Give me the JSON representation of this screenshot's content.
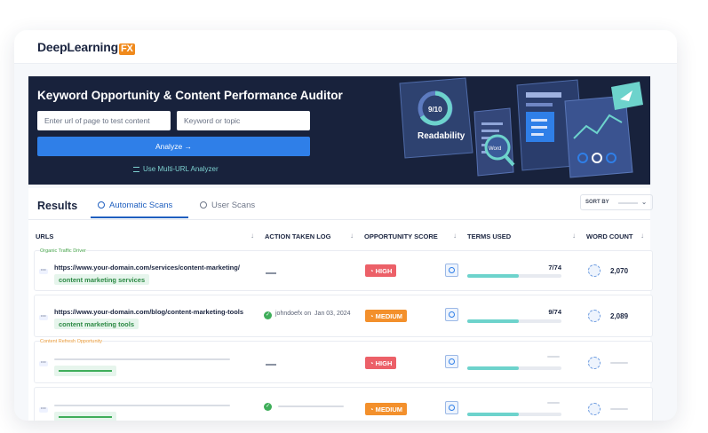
{
  "brand": {
    "name": "DeepLearning",
    "fx": "FX"
  },
  "hero": {
    "title": "Keyword Opportunity & Content Performance Auditor",
    "url_placeholder": "Enter url of page to test content",
    "keyword_placeholder": "Keyword or topic",
    "analyze_label": "Analyze →",
    "multi_label": "Use Multi-URL Analyzer",
    "readability_score": "9/10",
    "readability_label": "Readability",
    "word_label": "Word"
  },
  "results": {
    "title": "Results",
    "tabs": [
      {
        "label": "Automatic Scans"
      },
      {
        "label": "User Scans"
      }
    ],
    "sort_label": "SORT BY"
  },
  "table": {
    "columns": [
      "URLS",
      "ACTION TAKEN LOG",
      "OPPORTUNITY SCORE",
      "TERMS USED",
      "WORD COUNT"
    ],
    "rows": [
      {
        "tag": "Organic Traffic Driver",
        "url": "https://www.your-domain.com/services/content-marketing/",
        "keyword": "content marketing services",
        "log_user": "",
        "log_date": "",
        "score": "HIGH",
        "terms": "7/74",
        "terms_fraction": 0.55,
        "word_count": "2,070"
      },
      {
        "tag": "",
        "url": "https://www.your-domain.com/blog/content-marketing-tools",
        "keyword": "content marketing tools",
        "log_user": "johndoefx on",
        "log_date": "Jan 03, 2024",
        "score": "MEDIUM",
        "terms": "9/74",
        "terms_fraction": 0.55,
        "word_count": "2,089"
      },
      {
        "tag": "Content Refresh Opportunity",
        "url": "",
        "keyword": "",
        "score": "HIGH",
        "terms": "",
        "terms_fraction": 0.55,
        "word_count": ""
      },
      {
        "tag": "",
        "url": "",
        "keyword": "",
        "score": "MEDIUM",
        "terms": "",
        "terms_fraction": 0.55,
        "word_count": ""
      }
    ]
  },
  "colors": {
    "hero_bg": "#18223c",
    "accent": "#2f7fe8",
    "high": "#ec6068",
    "medium": "#f3902c",
    "terms_fill": "#6dd3cc"
  }
}
